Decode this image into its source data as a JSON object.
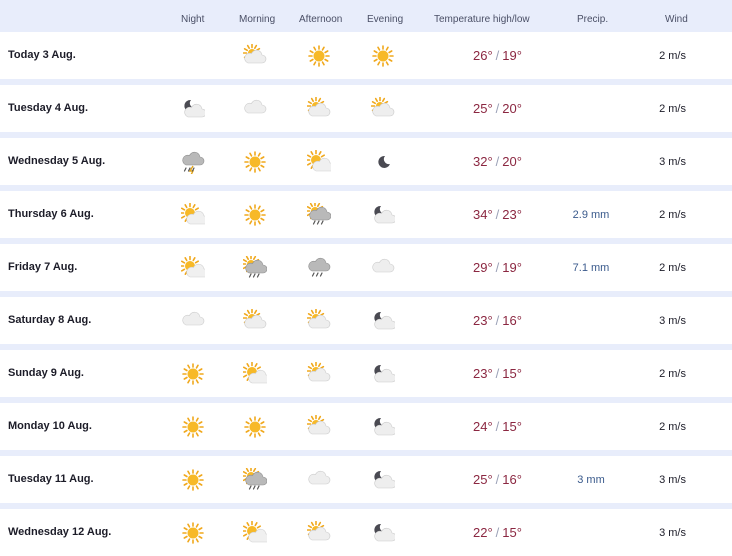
{
  "columns": {
    "night": "Night",
    "morning": "Morning",
    "afternoon": "Afternoon",
    "evening": "Evening",
    "temperature": "Temperature high/low",
    "precip": "Precip.",
    "wind": "Wind"
  },
  "days": [
    {
      "label": "Today 3 Aug.",
      "night": "",
      "morning": "partly-cloudy",
      "afternoon": "sun",
      "evening": "sun",
      "high": "26°",
      "low": "19°",
      "precip": "",
      "wind": "2 m/s"
    },
    {
      "label": "Tuesday 4 Aug.",
      "night": "moon-cloud",
      "morning": "cloud",
      "afternoon": "partly-cloudy",
      "evening": "partly-cloudy",
      "high": "25°",
      "low": "20°",
      "precip": "",
      "wind": "2 m/s"
    },
    {
      "label": "Wednesday 5 Aug.",
      "night": "thunderstorm",
      "morning": "sun",
      "afternoon": "sun-cloud",
      "evening": "moon",
      "high": "32°",
      "low": "20°",
      "precip": "",
      "wind": "3 m/s"
    },
    {
      "label": "Thursday 6 Aug.",
      "night": "sun-cloud",
      "morning": "sun",
      "afternoon": "sun-rain",
      "evening": "moon-cloud",
      "high": "34°",
      "low": "23°",
      "precip": "2.9 mm",
      "wind": "2 m/s"
    },
    {
      "label": "Friday 7 Aug.",
      "night": "sun-cloud",
      "morning": "sun-rain",
      "afternoon": "rain",
      "evening": "cloud",
      "high": "29°",
      "low": "19°",
      "precip": "7.1 mm",
      "wind": "2 m/s"
    },
    {
      "label": "Saturday 8 Aug.",
      "night": "cloud",
      "morning": "partly-cloudy",
      "afternoon": "partly-cloudy",
      "evening": "moon-cloud",
      "high": "23°",
      "low": "16°",
      "precip": "",
      "wind": "3 m/s"
    },
    {
      "label": "Sunday 9 Aug.",
      "night": "sun",
      "morning": "sun-cloud",
      "afternoon": "partly-cloudy",
      "evening": "moon-cloud",
      "high": "23°",
      "low": "15°",
      "precip": "",
      "wind": "2 m/s"
    },
    {
      "label": "Monday 10 Aug.",
      "night": "sun",
      "morning": "sun",
      "afternoon": "partly-cloudy",
      "evening": "moon-cloud",
      "high": "24°",
      "low": "15°",
      "precip": "",
      "wind": "2 m/s"
    },
    {
      "label": "Tuesday 11 Aug.",
      "night": "sun",
      "morning": "sun-rain",
      "afternoon": "cloud",
      "evening": "moon-cloud",
      "high": "25°",
      "low": "16°",
      "precip": "3 mm",
      "wind": "3 m/s"
    },
    {
      "label": "Wednesday 12 Aug.",
      "night": "sun",
      "morning": "sun-cloud",
      "afternoon": "partly-cloudy",
      "evening": "moon-cloud",
      "high": "22°",
      "low": "15°",
      "precip": "",
      "wind": "3 m/s"
    }
  ],
  "colors": {
    "high_low": "#8b2741",
    "precip": "#3a5a8c",
    "background": "#e8edfb"
  }
}
